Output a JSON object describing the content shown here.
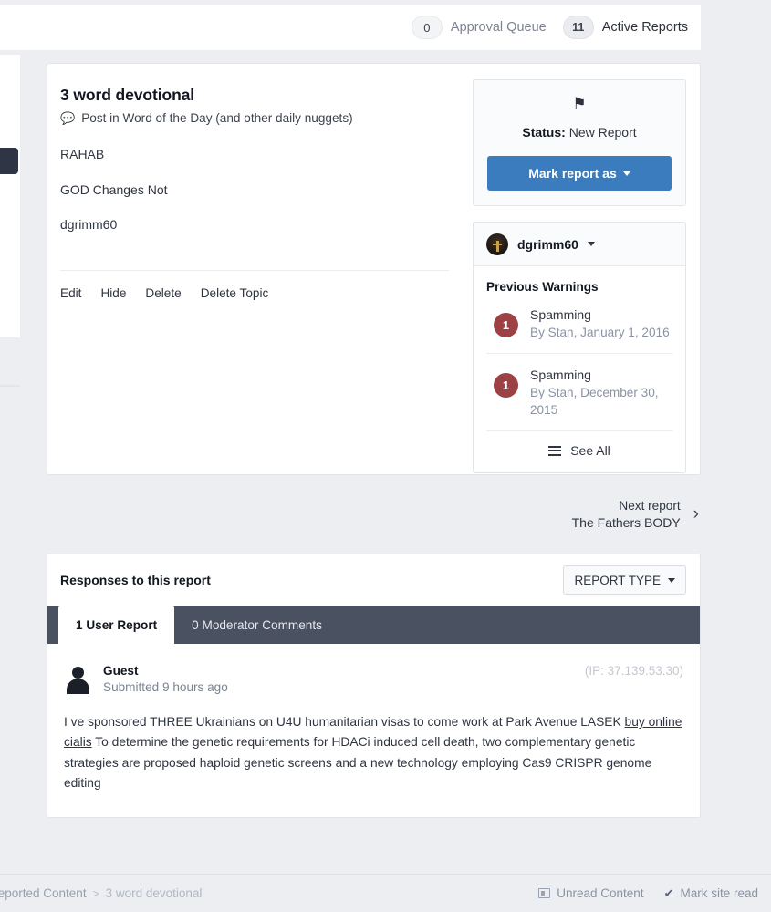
{
  "header": {
    "approval_queue_count": "0",
    "approval_queue_label": "Approval Queue",
    "active_reports_count": "11",
    "active_reports_label": "Active Reports"
  },
  "report": {
    "title": "3 word devotional",
    "subtitle": "Post in Word of the Day (and other daily nuggets)",
    "body_lines": [
      "RAHAB",
      "GOD Changes Not",
      "dgrimm60"
    ],
    "actions": [
      "Edit",
      "Hide",
      "Delete",
      "Delete Topic"
    ]
  },
  "status_panel": {
    "status_label": "Status:",
    "status_value": "New Report",
    "mark_button": "Mark report as"
  },
  "user_panel": {
    "username": "dgrimm60",
    "warnings_title": "Previous Warnings",
    "warnings": [
      {
        "count": "1",
        "reason": "Spamming",
        "meta": "By Stan, January 1, 2016"
      },
      {
        "count": "1",
        "reason": "Spamming",
        "meta": "By Stan, December 30, 2015"
      }
    ],
    "see_all": "See All"
  },
  "next_report": {
    "label": "Next report",
    "title": "The Fathers BODY"
  },
  "responses": {
    "heading": "Responses to this report",
    "report_type_button": "REPORT TYPE",
    "tabs": [
      {
        "label": "1 User Report",
        "active": true
      },
      {
        "label": "0 Moderator Comments",
        "active": false
      }
    ],
    "comment": {
      "author": "Guest",
      "submitted": "Submitted 9 hours ago",
      "ip": "(IP: 37.139.53.30)",
      "text_before": "I ve sponsored THREE Ukrainians on U4U humanitarian visas to come work at Park Avenue LASEK ",
      "link_text": "buy online cialis",
      "text_after": " To determine the genetic requirements for HDACi induced cell death, two complementary genetic strategies are proposed haploid genetic screens and a new technology employing Cas9 CRISPR genome editing"
    }
  },
  "footer": {
    "breadcrumb_parent": "Reported Content",
    "breadcrumb_sep": ">",
    "breadcrumb_current": "3 word devotional",
    "unread_content": "Unread Content",
    "mark_site_read": "Mark site read"
  },
  "colors": {
    "accent_blue": "#3a7cbd",
    "tabbar_dark": "#4a5262",
    "warn_badge_red": "#9c4146",
    "page_bg": "#eceef1"
  }
}
